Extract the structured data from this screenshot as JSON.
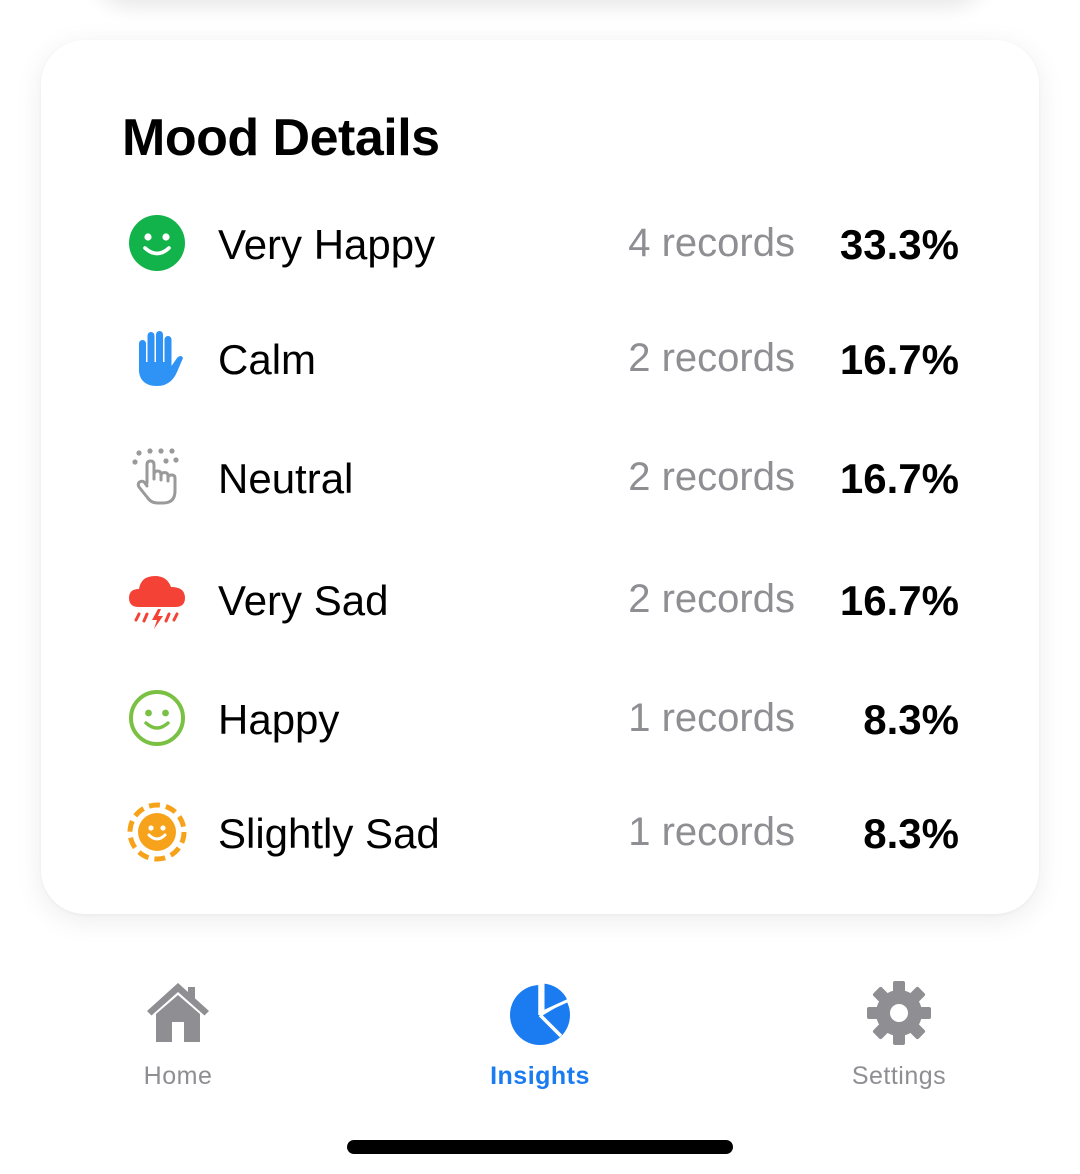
{
  "card": {
    "title": "Mood Details"
  },
  "moods": [
    {
      "label": "Very Happy",
      "count": "4 records",
      "percent": "33.3%",
      "icon": "smiley-filled-icon",
      "color": "#12b34a"
    },
    {
      "label": "Calm",
      "count": "2 records",
      "percent": "16.7%",
      "icon": "raised-hand-icon",
      "color": "#2f93f5"
    },
    {
      "label": "Neutral",
      "count": "2 records",
      "percent": "16.7%",
      "icon": "tapping-hand-icon",
      "color": "#9a9a9a"
    },
    {
      "label": "Very Sad",
      "count": "2 records",
      "percent": "16.7%",
      "icon": "thunderstorm-cloud-icon",
      "color": "#f44336"
    },
    {
      "label": "Happy",
      "count": "1 records",
      "percent": "8.3%",
      "icon": "smiley-outline-icon",
      "color": "#7ac143"
    },
    {
      "label": "Slightly Sad",
      "count": "1 records",
      "percent": "8.3%",
      "icon": "smiley-dashed-circle-icon",
      "color": "#f7a21b"
    }
  ],
  "tab_bar": {
    "tabs": [
      {
        "label": "Home",
        "icon": "house-icon",
        "active": false
      },
      {
        "label": "Insights",
        "icon": "pie-chart-icon",
        "active": true
      },
      {
        "label": "Settings",
        "icon": "gear-icon",
        "active": false
      }
    ],
    "active_color": "#1a7cf0",
    "inactive_color": "#8e8e93"
  }
}
